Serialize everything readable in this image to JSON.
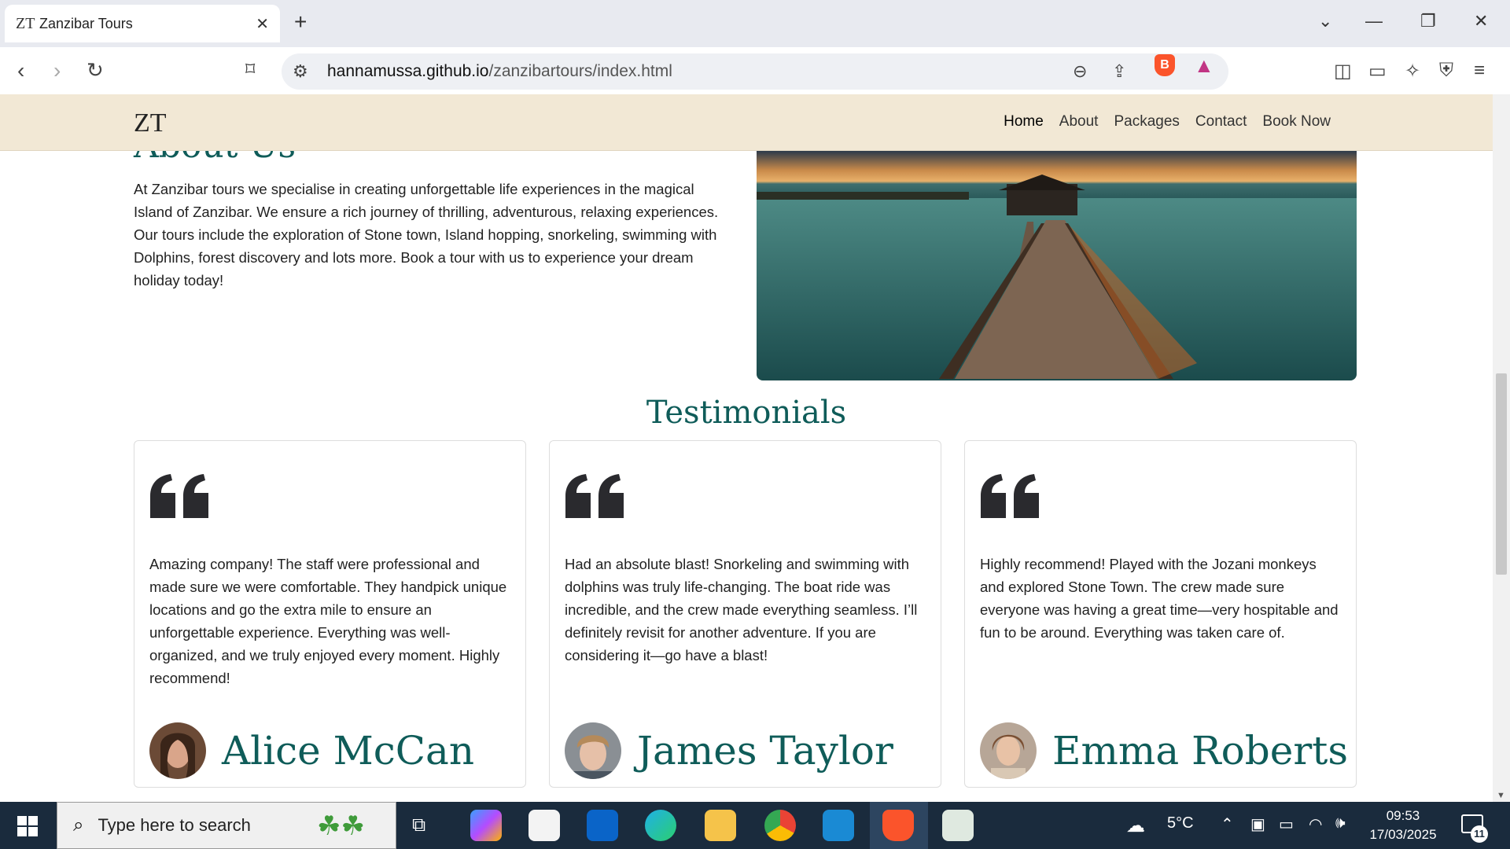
{
  "browser": {
    "tab_title": "Zanzibar Tours",
    "tab_favicon": "ZT",
    "url_host": "hannamussa.github.io",
    "url_path": "/zanzibartours/index.html"
  },
  "site": {
    "logo": "ZT",
    "nav": [
      "Home",
      "About",
      "Packages",
      "Contact",
      "Book Now"
    ],
    "nav_active": "Home",
    "about_heading": "About Us",
    "about_text": "At Zanzibar tours we specialise in creating unforgettable life experiences in the magical Island of Zanzibar. We ensure a rich journey of thrilling, adventurous, relaxing experiences. Our tours include the exploration of Stone town, Island hopping, snorkeling, swimming with Dolphins, forest discovery and lots more. Book a tour with us to experience your dream holiday today!",
    "testimonials_title": "Testimonials",
    "testimonials": [
      {
        "text": "Amazing company! The staff were professional and made sure we were comfortable. They handpick unique locations and go the extra mile to ensure an unforgettable experience. Everything was well-organized, and we truly enjoyed every moment. Highly recommend!",
        "name": "Alice McCan"
      },
      {
        "text": "Had an absolute blast! Snorkeling and swimming with dolphins was truly life-changing. The boat ride was incredible, and the crew made everything seamless. I’ll definitely revisit for another adventure. If you are considering it—go have a blast!",
        "name": "James Taylor"
      },
      {
        "text": "Highly recommend! Played with the Jozani monkeys and explored Stone Town. The crew made sure everyone was having a great time—very hospitable and fun to be around. Everything was taken care of.",
        "name": "Emma Roberts"
      }
    ]
  },
  "taskbar": {
    "search_placeholder": "Type here to search",
    "weather": "5°C",
    "time": "09:53",
    "date": "17/03/2025",
    "notification_count": "11"
  },
  "colors": {
    "accent_teal": "#0f5c59",
    "nav_bg": "#f2e8d5",
    "taskbar_bg": "#1a2b3d"
  }
}
